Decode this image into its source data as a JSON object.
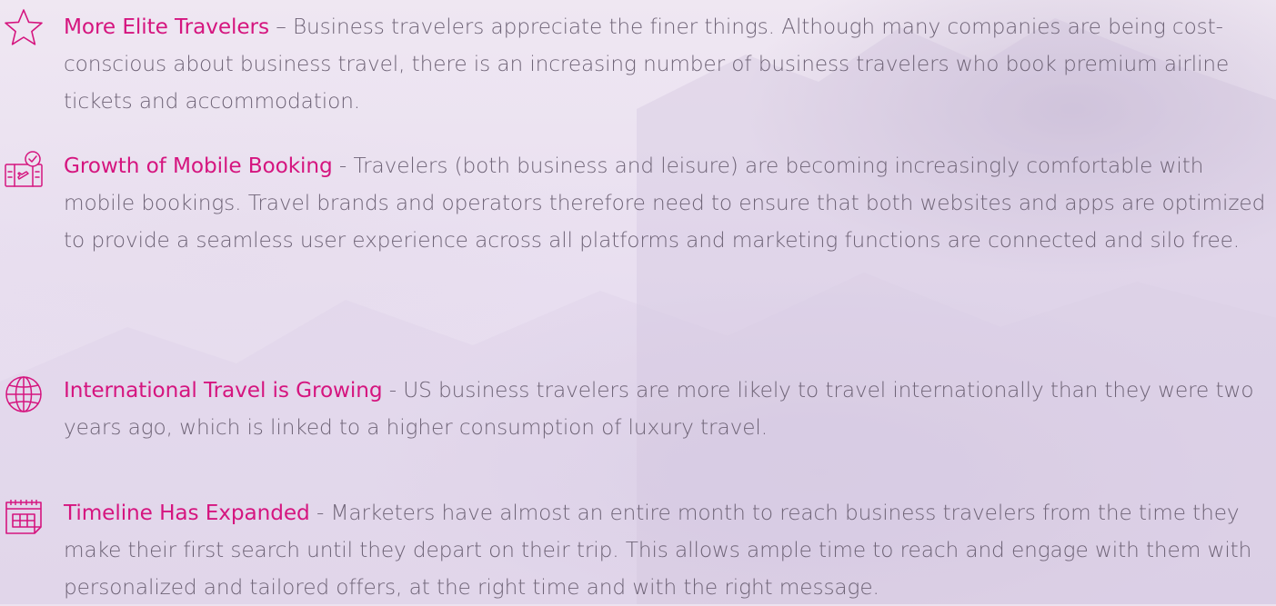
{
  "items": [
    {
      "icon": "star-icon",
      "title": "More Elite Travelers",
      "separator": " – ",
      "body": "Business travelers appreciate the finer things. Although many companies are being cost-conscious about business travel, there is an increasing number of business travelers who book premium airline tickets and accommodation."
    },
    {
      "icon": "mobile-booking-icon",
      "title": "Growth of Mobile Booking",
      "separator": " -  ",
      "body": "Travelers (both business and leisure) are becoming increasingly comfortable with mobile bookings. Travel brands and operators therefore need to ensure that both websites and apps are optimized to provide a seamless user experience across all platforms and marketing functions are connected and silo free."
    },
    {
      "icon": "globe-icon",
      "title": "International Travel is Growing",
      "separator": " - ",
      "body": "US business travelers are more likely to travel internationally than they were two years ago, which is linked to a higher consumption of luxury travel."
    },
    {
      "icon": "calendar-icon",
      "title": "Timeline Has Expanded",
      "separator": " - ",
      "body": "Marketers have almost an entire month to reach business travelers from the time they make their first search until they depart on their trip.  This allows ample time to reach and engage with them with personalized and tailored offers, at the right time and with the right message."
    }
  ],
  "colors": {
    "accent": "#d5157f",
    "body_text": "#6f6477",
    "background": "#ece3f0"
  }
}
